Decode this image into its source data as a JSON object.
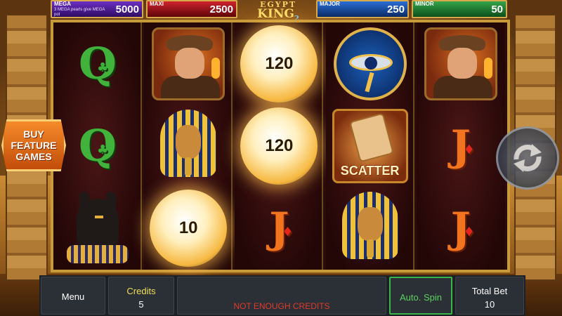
{
  "jackpots": {
    "mega": {
      "label": "MEGA",
      "value": "5000",
      "note": "3 MEGA pearls give MEGA pot"
    },
    "maxi": {
      "label": "MAXI",
      "value": "2500"
    },
    "major": {
      "label": "MAJOR",
      "value": "250"
    },
    "minor": {
      "label": "MINOR",
      "value": "50"
    },
    "colors": {
      "mega": "#6c2ec2",
      "maxi": "#d0232e",
      "major": "#2b6ed6",
      "minor": "#35a34a"
    }
  },
  "logo": {
    "line1": "EGYPT",
    "line2": "KING",
    "num": "2"
  },
  "reels": [
    [
      {
        "type": "q",
        "icon": "queen-clubs-icon"
      },
      {
        "type": "q",
        "icon": "queen-clubs-icon"
      },
      {
        "type": "anubis",
        "icon": "anubis-icon"
      }
    ],
    [
      {
        "type": "explorer",
        "icon": "explorer-icon"
      },
      {
        "type": "pharaoh",
        "icon": "pharaoh-icon"
      },
      {
        "type": "pearl",
        "value": "10"
      }
    ],
    [
      {
        "type": "pearl",
        "value": "120"
      },
      {
        "type": "pearl",
        "value": "120"
      },
      {
        "type": "j",
        "icon": "jack-diamonds-icon"
      }
    ],
    [
      {
        "type": "eye",
        "icon": "eye-of-horus-icon"
      },
      {
        "type": "scatter",
        "label": "SCATTER"
      },
      {
        "type": "pharaoh",
        "icon": "pharaoh-icon"
      }
    ],
    [
      {
        "type": "explorer",
        "icon": "explorer-icon"
      },
      {
        "type": "j",
        "icon": "jack-diamonds-icon"
      },
      {
        "type": "j",
        "icon": "jack-diamonds-icon"
      }
    ]
  ],
  "buy_feature": {
    "label": "BUY\nFEATURE\nGAMES"
  },
  "spin": {
    "icon": "spin-refresh-icon"
  },
  "bottom": {
    "menu_label": "Menu",
    "credits_label": "Credits",
    "credits_value": "5",
    "message": "NOT ENOUGH CREDITS",
    "auto_spin_label": "Auto. Spin",
    "total_bet_label": "Total Bet",
    "total_bet_value": "10"
  }
}
